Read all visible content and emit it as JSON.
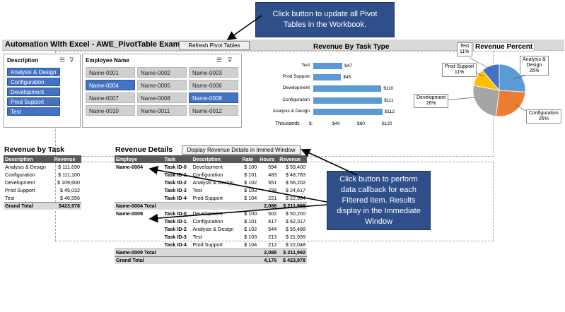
{
  "callouts": {
    "top": "Click button to update all Pivot Tables in the Workbook.",
    "right": "Click button to perform data callback for each Filtered Item. Results display in the Immediate Window"
  },
  "header": {
    "title": "Automation With Excel - AWE_PivotTable Example",
    "refresh_label": "Refresh Pivot Tables"
  },
  "description_slicer": {
    "title": "Description",
    "items": [
      "Analysis & Design",
      "Configuration",
      "Development",
      "Prod Support",
      "Test"
    ]
  },
  "employee_slicer": {
    "title": "Employee Name",
    "items": [
      {
        "label": "Name-0001",
        "selected": false
      },
      {
        "label": "Name-0002",
        "selected": false
      },
      {
        "label": "Name-0003",
        "selected": false
      },
      {
        "label": "Name-0004",
        "selected": true
      },
      {
        "label": "Name-0005",
        "selected": false
      },
      {
        "label": "Name-0006",
        "selected": false
      },
      {
        "label": "Name-0007",
        "selected": false
      },
      {
        "label": "Name-0008",
        "selected": false
      },
      {
        "label": "Name-0009",
        "selected": true
      },
      {
        "label": "Name-0010",
        "selected": false
      },
      {
        "label": "Name-0011",
        "selected": false
      },
      {
        "label": "Name-0012",
        "selected": false
      }
    ]
  },
  "chart_data": [
    {
      "type": "bar",
      "title": "Revenue By Task Type",
      "categories": [
        "Test",
        "Prod Support",
        "Development",
        "Configuration",
        "Analysis & Design"
      ],
      "values": [
        47,
        45,
        110,
        111,
        112
      ],
      "value_labels": [
        "$47",
        "$45",
        "$110",
        "$111",
        "$112"
      ],
      "xlabel": "Thousands",
      "x_ticks": [
        "$-",
        "$40",
        "$80",
        "$120"
      ],
      "xlim": [
        0,
        120
      ],
      "color": "#5b9bd5"
    },
    {
      "type": "pie",
      "title": "Revenue Percent",
      "categories": [
        "Analysis & Design",
        "Configuration",
        "Development",
        "Prod Support",
        "Test"
      ],
      "values": [
        26,
        26,
        26,
        11,
        11
      ],
      "labels": [
        "Analysis & Design 26%",
        "Configuration 26%",
        "Development 26%",
        "Prod Support 11%",
        "Test 11%"
      ],
      "colors": [
        "#5b9bd5",
        "#ed7d31",
        "#a5a5a5",
        "#ffc000",
        "#4472c4"
      ]
    }
  ],
  "revenue_by_task": {
    "title": "Revenue by Task",
    "headers": [
      "Description",
      "Revenue"
    ],
    "rows": [
      [
        "Analysis & Design",
        "$ 111,690"
      ],
      [
        "Configuration",
        "$ 111,100"
      ],
      [
        "Development",
        "$ 109,600"
      ],
      [
        "Prod Support",
        "$ 45,032"
      ],
      [
        "Test",
        "$ 46,556"
      ]
    ],
    "total": [
      "Grand Total",
      "$423,978"
    ]
  },
  "revenue_details": {
    "title": "Revenue Details",
    "button_label": "Display Revenue Details in Immed Window",
    "headers": [
      "Employe",
      "Task",
      "Description",
      "Rate",
      "Hours",
      "Revenue"
    ],
    "rows": [
      [
        "Name-0004",
        "Task ID-0",
        "Development",
        "$ 100",
        "594",
        "$ 59,400"
      ],
      [
        "",
        "Task ID-1",
        "Configuration",
        "$ 101",
        "483",
        "$ 48,783"
      ],
      [
        "",
        "Task ID-2",
        "Analysis & Design",
        "$ 102",
        "551",
        "$ 56,202"
      ],
      [
        "",
        "Task ID-3",
        "Test",
        "$ 103",
        "239",
        "$ 24,617"
      ],
      [
        "",
        "Task ID-4",
        "Prod Support",
        "$ 104",
        "221",
        "$ 22,984"
      ],
      [
        "Name-0004 Total",
        "",
        "",
        "",
        "2,088",
        "$ 211,986"
      ],
      [
        "Name-0009",
        "Task ID-0",
        "Development",
        "$ 100",
        "502",
        "$ 50,200"
      ],
      [
        "",
        "Task ID-1",
        "Configuration",
        "$ 101",
        "617",
        "$ 62,317"
      ],
      [
        "",
        "Task ID-2",
        "Analysis & Design",
        "$ 102",
        "544",
        "$ 55,488"
      ],
      [
        "",
        "Task ID-3",
        "Test",
        "$ 103",
        "213",
        "$ 21,939"
      ],
      [
        "",
        "Task ID-4",
        "Prod Support",
        "$ 104",
        "212",
        "$ 22,048"
      ],
      [
        "Name-0009 Total",
        "",
        "",
        "",
        "2,088",
        "$ 211,992"
      ],
      [
        "Grand Total",
        "",
        "",
        "",
        "4,176",
        "$ 423,978"
      ]
    ]
  }
}
